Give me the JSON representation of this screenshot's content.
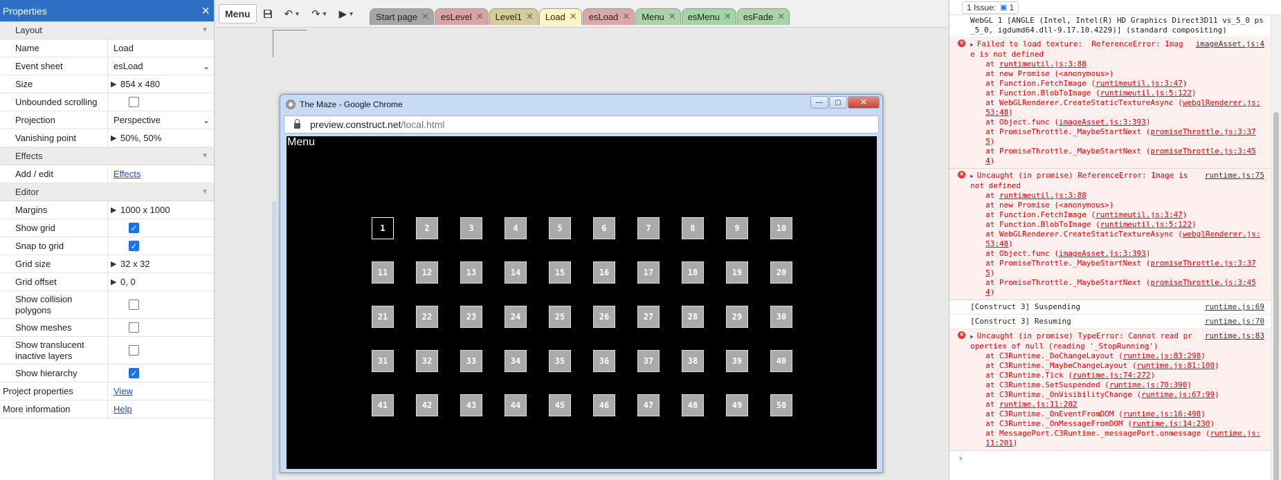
{
  "properties": {
    "title": "Properties",
    "close_icon": "×",
    "sections": {
      "layout": "Layout",
      "effects": "Effects",
      "editor": "Editor"
    },
    "rows": {
      "name": {
        "label": "Name",
        "value": "Load"
      },
      "event_sheet": {
        "label": "Event sheet",
        "value": "esLoad"
      },
      "size": {
        "label": "Size",
        "value": "854 x 480"
      },
      "unbounded": {
        "label": "Unbounded scrolling",
        "checked": false
      },
      "projection": {
        "label": "Projection",
        "value": "Perspective"
      },
      "vanishing": {
        "label": "Vanishing point",
        "value": "50%, 50%"
      },
      "add_edit": {
        "label": "Add / edit",
        "link": "Effects"
      },
      "margins": {
        "label": "Margins",
        "value": "1000 x 1000"
      },
      "show_grid": {
        "label": "Show grid",
        "checked": true
      },
      "snap_grid": {
        "label": "Snap to grid",
        "checked": true
      },
      "grid_size": {
        "label": "Grid size",
        "value": "32 x 32"
      },
      "grid_offset": {
        "label": "Grid offset",
        "value": "0, 0"
      },
      "collision": {
        "label": "Show collision polygons",
        "checked": false
      },
      "meshes": {
        "label": "Show meshes",
        "checked": false
      },
      "translucent": {
        "label": "Show translucent inactive layers",
        "checked": false
      },
      "hierarchy": {
        "label": "Show hierarchy",
        "checked": true
      },
      "project_props": {
        "label": "Project properties",
        "link": "View"
      },
      "more_info": {
        "label": "More information",
        "link": "Help"
      }
    }
  },
  "toolbar": {
    "menu_label": "Menu",
    "tabs": [
      {
        "label": "Start page",
        "color": "#a6a6a6"
      },
      {
        "label": "esLevel",
        "color": "#d8a3a3"
      },
      {
        "label": "Level1",
        "color": "#d6cc9a"
      },
      {
        "label": "Load",
        "color": "#fbf6c4"
      },
      {
        "label": "esLoad",
        "color": "#dba8a8"
      },
      {
        "label": "Menu",
        "color": "#a9d4a9"
      },
      {
        "label": "esMenu",
        "color": "#a3d6a3"
      },
      {
        "label": "esFade",
        "color": "#a8d4a8"
      }
    ]
  },
  "browser": {
    "title": "The Maze - Google Chrome",
    "url_host": "preview.construct.net",
    "url_path": "/local.html",
    "game_label": "Menu",
    "levels": [
      "1",
      "2",
      "3",
      "4",
      "5",
      "6",
      "7",
      "8",
      "9",
      "10",
      "11",
      "12",
      "13",
      "14",
      "15",
      "16",
      "17",
      "18",
      "19",
      "20",
      "21",
      "22",
      "23",
      "24",
      "25",
      "26",
      "27",
      "28",
      "29",
      "30",
      "31",
      "32",
      "33",
      "34",
      "35",
      "36",
      "37",
      "38",
      "39",
      "40",
      "41",
      "42",
      "43",
      "44",
      "45",
      "46",
      "47",
      "48",
      "49",
      "50"
    ]
  },
  "console": {
    "issues_label": "1 Issue:",
    "issues_count": "1",
    "top_line": "WebGL 1 [ANGLE (Intel, Intel(R) HD Graphics Direct3D11 vs_5_0 ps_5_0, igdumd64.dll-9.17.10.4229)] (standard compositing)",
    "messages": [
      {
        "type": "err",
        "text": "Failed to load texture:  ReferenceError: Image is not defined",
        "src": "imageAsset.js:4",
        "stack": [
          [
            "at ",
            "runtimeutil.js:3:88",
            ""
          ],
          [
            "at new Promise (<anonymous>)",
            "",
            ""
          ],
          [
            "at Function.FetchImage (",
            "runtimeutil.js:3:47",
            ")"
          ],
          [
            "at Function.BlobToImage (",
            "runtimeutil.js:5:122",
            ")"
          ],
          [
            "at WebGLRenderer.CreateStaticTextureAsync (",
            "webglRenderer.js:53:48",
            ")"
          ],
          [
            "at Object.func (",
            "imageAsset.js:3:393",
            ")"
          ],
          [
            "at PromiseThrottle._MaybeStartNext (",
            "promiseThrottle.js:3:375",
            ")"
          ],
          [
            "at PromiseThrottle._MaybeStartNext (",
            "promiseThrottle.js:3:454",
            ")"
          ]
        ]
      },
      {
        "type": "err",
        "text": "Uncaught (in promise) ReferenceError: Image is not defined",
        "src": "runtime.js:75",
        "stack": [
          [
            "at ",
            "runtimeutil.js:3:88",
            ""
          ],
          [
            "at new Promise (<anonymous>)",
            "",
            ""
          ],
          [
            "at Function.FetchImage (",
            "runtimeutil.js:3:47",
            ")"
          ],
          [
            "at Function.BlobToImage (",
            "runtimeutil.js:5:122",
            ")"
          ],
          [
            "at WebGLRenderer.CreateStaticTextureAsync (",
            "webglRenderer.js:53:48",
            ")"
          ],
          [
            "at Object.func (",
            "imageAsset.js:3:393",
            ")"
          ],
          [
            "at PromiseThrottle._MaybeStartNext (",
            "promiseThrottle.js:3:375",
            ")"
          ],
          [
            "at PromiseThrottle._MaybeStartNext (",
            "promiseThrottle.js:3:454",
            ")"
          ]
        ]
      },
      {
        "type": "log",
        "text": "[Construct 3] Suspending",
        "src": "runtime.js:69",
        "stack": []
      },
      {
        "type": "log",
        "text": "[Construct 3] Resuming",
        "src": "runtime.js:70",
        "stack": []
      },
      {
        "type": "err",
        "text": "Uncaught (in promise) TypeError: Cannot read properties of null (reading '_StopRunning')",
        "src": "runtime.js:83",
        "stack": [
          [
            "at C3Runtime._DoChangeLayout (",
            "runtime.js:83:298",
            ")"
          ],
          [
            "at C3Runtime._MaybeChangeLayout (",
            "runtime.js:81:100",
            ")"
          ],
          [
            "at C3Runtime.Tick (",
            "runtime.js:74:272",
            ")"
          ],
          [
            "at C3Runtime.SetSuspended (",
            "runtime.js:70:390",
            ")"
          ],
          [
            "at C3Runtime._OnVisibilityChange (",
            "runtime.js:67:99",
            ")"
          ],
          [
            "at ",
            "runtime.js:11:282",
            ""
          ],
          [
            "at C3Runtime._OnEventFromDOM (",
            "runtime.js:16:498",
            ")"
          ],
          [
            "at C3Runtime._OnMessageFromDOM (",
            "runtime.js:14:230",
            ")"
          ],
          [
            "at MessagePort.C3Runtime._messagePort.onmessage (",
            "runtime.js:11:201",
            ")"
          ]
        ]
      }
    ],
    "prompt": "›"
  }
}
